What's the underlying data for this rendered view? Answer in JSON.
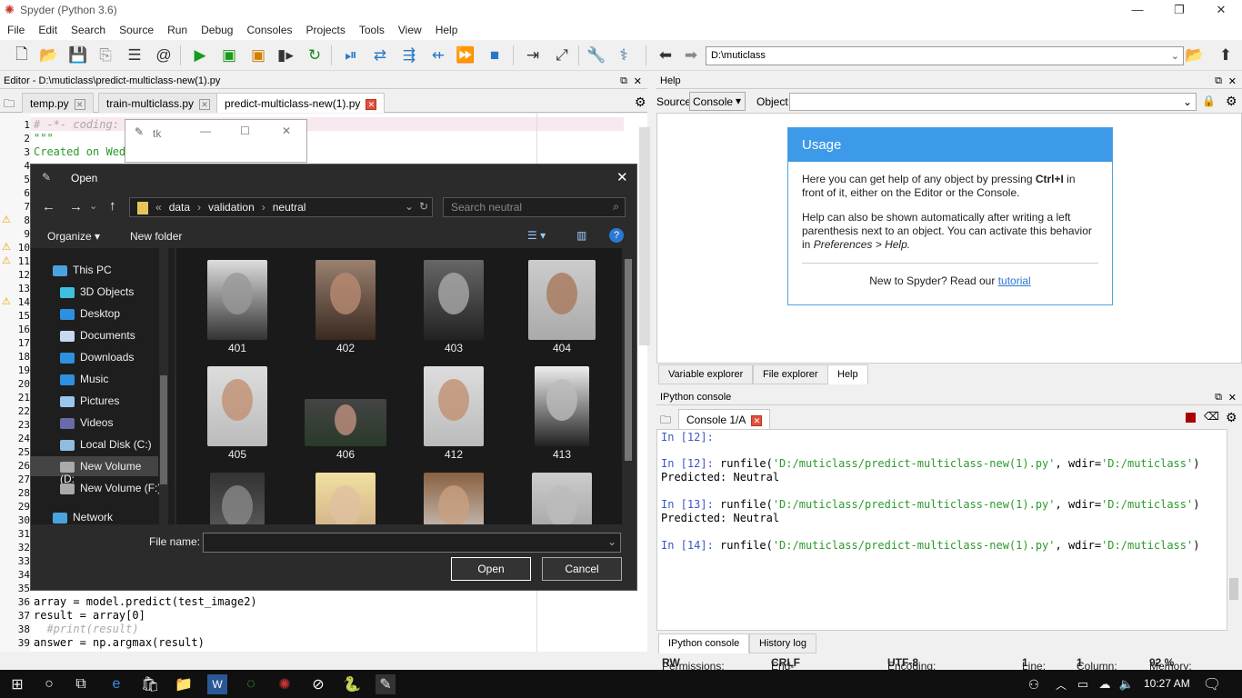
{
  "window": {
    "title": "Spyder (Python 3.6)"
  },
  "menu": [
    "File",
    "Edit",
    "Search",
    "Source",
    "Run",
    "Debug",
    "Consoles",
    "Projects",
    "Tools",
    "View",
    "Help"
  ],
  "toolbar": {
    "path": "D:\\muticlass"
  },
  "editor": {
    "header": "Editor - D:\\muticlass\\predict-multiclass-new(1).py",
    "tabs": [
      "temp.py",
      "train-multiclass.py",
      "predict-multiclass-new(1).py"
    ],
    "lines_top": [
      "1",
      "2",
      "3"
    ],
    "code_top": [
      "# -*- coding: ",
      "\"\"\"",
      "Created on Wed"
    ],
    "line_numbers": [
      "4",
      "5",
      "6",
      "7",
      "8",
      "9",
      "10",
      "11",
      "12",
      "13",
      "14",
      "15",
      "16",
      "17",
      "18",
      "19",
      "20",
      "21",
      "22",
      "23",
      "24",
      "25",
      "26",
      "27",
      "28",
      "29",
      "30",
      "31",
      "32",
      "33",
      "34",
      "35"
    ],
    "lines_bottom": [
      "36",
      "37",
      "38",
      "39"
    ],
    "code_bottom": [
      "array = model.predict(test_image2)",
      "result = array[0]",
      "  #print(result)",
      "answer = np.argmax(result)"
    ]
  },
  "tk": {
    "title": "tk"
  },
  "dialog": {
    "title": "Open",
    "breadcrumb": [
      "data",
      "validation",
      "neutral"
    ],
    "search_placeholder": "Search neutral",
    "organize": "Organize",
    "new_folder": "New folder",
    "nav": [
      "This PC",
      "3D Objects",
      "Desktop",
      "Documents",
      "Downloads",
      "Music",
      "Pictures",
      "Videos",
      "Local Disk (C:)",
      "New Volume (D:",
      "New Volume (F:)",
      "Network"
    ],
    "files": [
      "401",
      "402",
      "403",
      "404",
      "405",
      "406",
      "412",
      "413",
      "",
      "",
      "",
      ""
    ],
    "filename_label": "File name:",
    "open": "Open",
    "cancel": "Cancel"
  },
  "help": {
    "header": "Help",
    "source_label": "Source",
    "source_value": "Console",
    "object_label": "Object",
    "usage_title": "Usage",
    "p1a": "Here you can get help of any object by pressing ",
    "p1b": "Ctrl+I",
    "p1c": " in front of it, either on the Editor or the Console.",
    "p2": "Help can also be shown automatically after writing a left parenthesis next to an object. You can activate this behavior in",
    "p2b": "Preferences > Help.",
    "p3": "New to Spyder? Read our ",
    "p3link": "tutorial",
    "tabs": [
      "Variable explorer",
      "File explorer",
      "Help"
    ]
  },
  "ipython": {
    "header": "IPython console",
    "tab": "Console 1/A",
    "lines": [
      {
        "prompt": "In [12]:",
        "cmd": "",
        "fn": "",
        "tail": ""
      },
      {
        "prompt": "In [12]:",
        "cmd": " runfile(",
        "fn": "'D:/muticlass/predict-multiclass-new(1).py'",
        "tail": ", wdir=",
        "wdir": "'D:/muticlass'"
      },
      {
        "out": "Predicted: Neutral"
      },
      {
        "prompt": "In [13]:",
        "cmd": " runfile(",
        "fn": "'D:/muticlass/predict-multiclass-new(1).py'",
        "tail": ", wdir=",
        "wdir": "'D:/muticlass'"
      },
      {
        "out": "Predicted: Neutral"
      },
      {
        "prompt": "In [14]:",
        "cmd": " runfile(",
        "fn": "'D:/muticlass/predict-multiclass-new(1).py'",
        "tail": ", wdir=",
        "wdir": "'D:/muticlass'"
      }
    ],
    "bottom_tabs": [
      "IPython console",
      "History log"
    ]
  },
  "status": {
    "permissions_label": "Permissions:",
    "permissions": "RW",
    "eol_label": "End-of-lines:",
    "eol": "CRLF",
    "encoding_label": "Encoding:",
    "encoding": "UTF-8",
    "line_label": "Line:",
    "line": "1",
    "column_label": "Column:",
    "column": "1",
    "memory_label": "Memory:",
    "memory": "92 %"
  },
  "taskbar": {
    "time": "10:27 AM"
  }
}
